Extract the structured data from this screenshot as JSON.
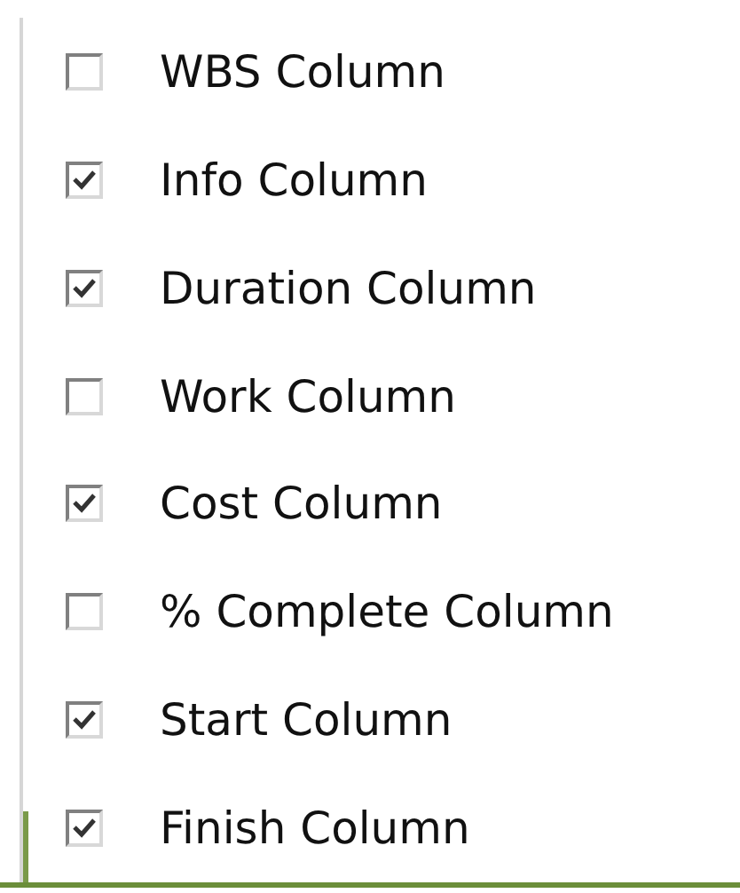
{
  "options": [
    {
      "label": "WBS Column",
      "checked": false
    },
    {
      "label": "Info Column",
      "checked": true
    },
    {
      "label": "Duration Column",
      "checked": true
    },
    {
      "label": "Work Column",
      "checked": false
    },
    {
      "label": "Cost Column",
      "checked": true
    },
    {
      "label": "% Complete Column",
      "checked": false
    },
    {
      "label": "Start Column",
      "checked": true
    },
    {
      "label": "Finish Column",
      "checked": true
    }
  ]
}
